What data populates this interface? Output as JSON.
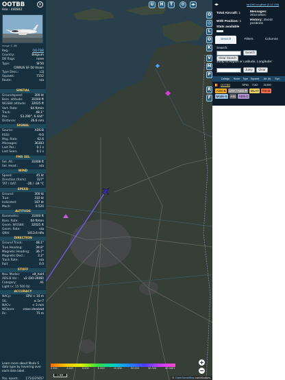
{
  "aircraft": {
    "callsign": "OOTBB",
    "hex_label": "Hex :",
    "hex": "440842",
    "photo_credit": "Image © JBS"
  },
  "details": [
    {
      "k": "Reg.:",
      "v": "OO-TBB",
      "link": true
    },
    {
      "k": "Country:",
      "v": "Belgium"
    },
    {
      "k": "DB flags:",
      "v": "none"
    },
    {
      "k": "Type:",
      "v": "SF50"
    }
  ],
  "model": "CIRRUS SF-50 Vision",
  "details2": [
    {
      "k": "Type Desc.:",
      "v": "L1J"
    },
    {
      "k": "Squawk:",
      "v": "7152"
    },
    {
      "k": "Route:",
      "v": "n/a"
    }
  ],
  "sections": [
    {
      "name": "SPATIAL",
      "rows": [
        {
          "k": "Groundspeed:",
          "v": "300 kt"
        },
        {
          "k": "Baro. altitude:",
          "v": "31000 ft"
        },
        {
          "k": "WGS84 altitude:",
          "v": "32025 ft"
        },
        {
          "k": "Vert. Rate:",
          "v": "64 ft/min"
        },
        {
          "k": "Track:",
          "v": "48.1°"
        },
        {
          "k": "Pos.:",
          "v": "53.290°, 6.444°"
        },
        {
          "k": "Distance:",
          "v": "26.6 nmi"
        }
      ]
    },
    {
      "name": "SIGNAL",
      "rows": [
        {
          "k": "Source:",
          "v": "ADS-B"
        },
        {
          "k": "RSSI:",
          "v": "-9.0"
        },
        {
          "k": "Msg. Rate:",
          "v": "62.6"
        },
        {
          "k": "Messages:",
          "v": "36383"
        },
        {
          "k": "Last Pos.:",
          "v": "0.1 s"
        },
        {
          "k": "Last Seen:",
          "v": "0.1 s"
        }
      ]
    },
    {
      "name": "FMS SEL",
      "rows": [
        {
          "k": "Sel. Alt.:",
          "v": "31008 ft"
        },
        {
          "k": "Sel. Head.:",
          "v": "n/a"
        }
      ]
    },
    {
      "name": "WIND",
      "rows": [
        {
          "k": "Speed:",
          "v": "45 kt"
        },
        {
          "k": "Direction (from):",
          "v": "327°"
        },
        {
          "k": "TAT / OAT:",
          "v": "-26 / -39 °C"
        }
      ]
    },
    {
      "name": "SPEED",
      "rows": [
        {
          "k": "Ground:",
          "v": "300 kt"
        },
        {
          "k": "True:",
          "v": "310 kt"
        },
        {
          "k": "Indicated:",
          "v": "187 kt"
        },
        {
          "k": "Mach:",
          "v": "0.520"
        }
      ]
    },
    {
      "name": "ALTITUDE",
      "rows": [
        {
          "k": "Barometric:",
          "v": "31000 ft"
        },
        {
          "k": "Baro. Rate:",
          "v": "64 ft/min"
        },
        {
          "k": "Geom. WGS84:",
          "v": "32025 ft"
        },
        {
          "k": "Geom. Rate:",
          "v": "n/a"
        },
        {
          "k": "QNH:",
          "v": "1013.6 hPa"
        }
      ]
    },
    {
      "name": "DIRECTION",
      "rows": [
        {
          "k": "Ground Track:",
          "v": "48.1°"
        },
        {
          "k": "True Heading:",
          "v": "39.8°"
        },
        {
          "k": "Magnetic Heading:",
          "v": "36.7°"
        },
        {
          "k": "Magnetic Decl.:",
          "v": "3.2°"
        },
        {
          "k": "Track Rate:",
          "v": "n/a"
        },
        {
          "k": "Roll:",
          "v": "0.0"
        }
      ]
    },
    {
      "name": "STUFF",
      "rows": [
        {
          "k": "Nav. Modes:",
          "v": "alt_hold"
        },
        {
          "k": "ADS-B Ver.:",
          "v": "v2 (DO-260B)"
        },
        {
          "k": "Category:",
          "v": "A1"
        },
        {
          "k": "Light (< 15 500 lb)",
          "v": ""
        }
      ]
    },
    {
      "name": "ACCURACY",
      "rows": [
        {
          "k": "NACp:",
          "v": "EPU < 10 m"
        },
        {
          "k": "SIL:",
          "v": "≤ 1e-7"
        },
        {
          "k": "NACv:",
          "v": "< 3 m/s"
        },
        {
          "k": "NICbaro:",
          "v": "cross-checked"
        },
        {
          "k": "Rc:",
          "v": "75 m"
        }
      ]
    }
  ],
  "learn_more": "Learn more about Mode S data type by hovering over each data label.",
  "pos_epoch": {
    "k": "Pos. epoch:",
    "v": "1754225657"
  },
  "map": {
    "top_buttons": [
      "U",
      "H",
      "T"
    ],
    "side_buttons": [
      "O",
      "L",
      "O",
      "K",
      "V",
      "M",
      "P",
      "R",
      "F"
    ],
    "zoom_in": "+",
    "zoom_out": "−",
    "altitude_ticks": [
      "2 000",
      "4 000",
      "6 000",
      "8 000",
      "10 000",
      "20 000",
      "30 000",
      "40 000+"
    ],
    "scale": "1 NM",
    "attribution_prefix": "©",
    "attribution_link": "OpenStreetMap",
    "attribution_suffix": "contributors."
  },
  "right": {
    "github": "tar1090 on github (3.14.1706",
    "total_label": "Total Aircraft:",
    "total": "1",
    "with_pos_label": "With Position:",
    "with_pos": "1",
    "stats_label": "Stats available",
    "messages_label": "Messages:",
    "messages_rate": "2010.8/sec",
    "history_label": "History:",
    "history": "25443 positions",
    "tabs": [
      "Search",
      "Filters",
      "Columns"
    ],
    "search_label": "Search:",
    "search_button": "Search",
    "clear_search_button": "Clear Search",
    "jump_label": "Jump to Airport or Latitude, Longitude:",
    "jump_button": "Jump",
    "clear_button": "Clear",
    "columns": [
      "",
      "Callsign",
      "Route",
      "Type",
      "Squawk",
      "Alt. (ft)",
      "Spd."
    ],
    "row": {
      "callsign": "OOTBB",
      "route": "",
      "type": "SF50",
      "squawk": "7152",
      "alt": "31000",
      "spd": ""
    },
    "flag_colors": [
      "#111111",
      "#ffd400",
      "#e2231a"
    ],
    "legend_chips": [
      "ADS-B",
      "UAT / ADS-R",
      "MLAT",
      "TIS-B",
      "Mode-S",
      "AIS",
      "ADS-C"
    ]
  },
  "colors": {
    "panel": "#17303f",
    "map_track": "#7b5cff",
    "aircraft": "#3b2bd8",
    "accent": "#1f5c86"
  }
}
